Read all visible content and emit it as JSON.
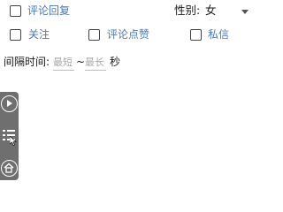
{
  "comment_reply": {
    "label": "评论回复",
    "checked": false
  },
  "gender": {
    "label": "性别:",
    "selected": "女"
  },
  "options": {
    "follow_label": "关注",
    "comment_like_label": "评论点赞",
    "private_msg_label": "私信"
  },
  "interval": {
    "label": "间隔时间:",
    "min_placeholder": "最短",
    "separator": "~",
    "max_placeholder": "最长",
    "unit": "秒"
  },
  "colors": {
    "label_accent": "#4a78b8",
    "float_bar": "#6f6f6f"
  },
  "icons": [
    "play-circle-icon",
    "list-icon",
    "home-icon",
    "cursor-icon"
  ]
}
